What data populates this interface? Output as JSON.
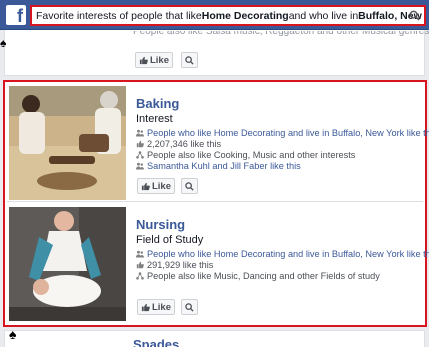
{
  "header": {
    "logo_letter": "f",
    "search_parts": [
      {
        "text": "Favorite interests of people that like ",
        "bold": false
      },
      {
        "text": "Home Decorating",
        "bold": true
      },
      {
        "text": " and who live in ",
        "bold": false
      },
      {
        "text": "Buffalo, New York",
        "bold": true
      }
    ]
  },
  "previous_card": {
    "text": "People also like Salsa music, Reggaeton and other Musical genres",
    "like_label": "Like"
  },
  "results": [
    {
      "title": "Baking",
      "subtitle": "Interest",
      "lines": [
        {
          "icon": "people-icon",
          "text": "People who like Home Decorating and live in Buffalo, New York like this",
          "link": true
        },
        {
          "icon": "thumbs-up-icon",
          "text": "2,207,346 like this",
          "link": false
        },
        {
          "icon": "network-icon",
          "text": "People also like Cooking, Music and other interests",
          "link": false
        },
        {
          "icon": "people-icon",
          "text": "Samantha Kuhl and Jill Faber like this",
          "link": true
        }
      ],
      "like_label": "Like"
    },
    {
      "title": "Nursing",
      "subtitle": "Field of Study",
      "lines": [
        {
          "icon": "people-icon",
          "text": "People who like Home Decorating and live in Buffalo, New York like this",
          "link": true
        },
        {
          "icon": "thumbs-up-icon",
          "text": "291,929 like this",
          "link": false
        },
        {
          "icon": "network-icon",
          "text": "People also like Music, Dancing and other Fields of study",
          "link": false
        }
      ],
      "like_label": "Like"
    }
  ],
  "next_card": {
    "title": "Spades"
  },
  "colors": {
    "brand_blue": "#3b5998",
    "highlight_red": "#d8151f"
  }
}
